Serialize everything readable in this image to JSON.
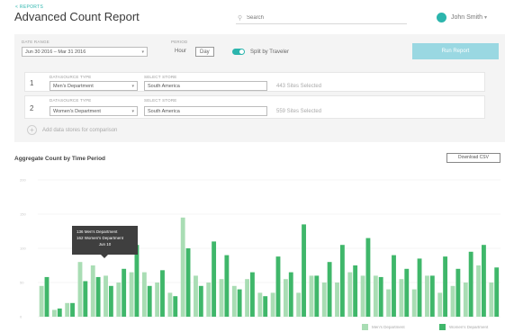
{
  "header": {
    "breadcrumb": "< REPORTS",
    "title": "Advanced Count Report",
    "search_placeholder": "Search",
    "user_name": "John Smith"
  },
  "filters": {
    "date_range_label": "DATE RANGE",
    "date_range_value": "Jun 30 2016 – Mar 31 2016",
    "period_label": "PERIOD",
    "period_options": [
      "Hour",
      "Day"
    ],
    "period_selected": "Day",
    "split_label": "Split by Traveler",
    "split_on": true,
    "run_button": "Run Report",
    "datasources": [
      {
        "index": "1",
        "type_label": "DATASOURCE TYPE",
        "type_value": "Men's Department",
        "source_label": "SELECT STORE",
        "source_value": "South America",
        "count": "443 Sites Selected"
      },
      {
        "index": "2",
        "type_label": "DATASOURCE TYPE",
        "type_value": "Women's Department",
        "source_label": "SELECT STORE",
        "source_value": "South America",
        "count": "559 Sites Selected"
      }
    ],
    "add_datasource": "Add data stores for comparison"
  },
  "chart_section": {
    "title": "Aggregate Count by Time Period",
    "download_label": "Download CSV",
    "tooltip_line1": "136 Men's Department",
    "tooltip_line2": "162 Women's Department",
    "tooltip_line3": "Jun 10"
  },
  "chart_data": {
    "type": "bar",
    "ylim": [
      0,
      200
    ],
    "yticks": [
      "200",
      "150",
      "100",
      "50",
      "0"
    ],
    "grid": true,
    "legend_position": "bottom-right",
    "series": [
      {
        "name": "Men's Department",
        "color": "#a9ddb4",
        "values": [
          45,
          10,
          20,
          80,
          75,
          60,
          50,
          65,
          65,
          50,
          35,
          145,
          60,
          50,
          55,
          45,
          55,
          35,
          35,
          55,
          35,
          60,
          50,
          50,
          65,
          60,
          60,
          40,
          55,
          40,
          60,
          35,
          45,
          50,
          75,
          50
        ]
      },
      {
        "name": "Women's Department",
        "color": "#3fb76a",
        "values": [
          58,
          12,
          20,
          52,
          58,
          45,
          70,
          105,
          45,
          68,
          30,
          100,
          45,
          110,
          90,
          40,
          65,
          30,
          88,
          65,
          135,
          60,
          80,
          105,
          75,
          115,
          58,
          90,
          70,
          85,
          60,
          88,
          70,
          95,
          105,
          72
        ]
      }
    ]
  }
}
